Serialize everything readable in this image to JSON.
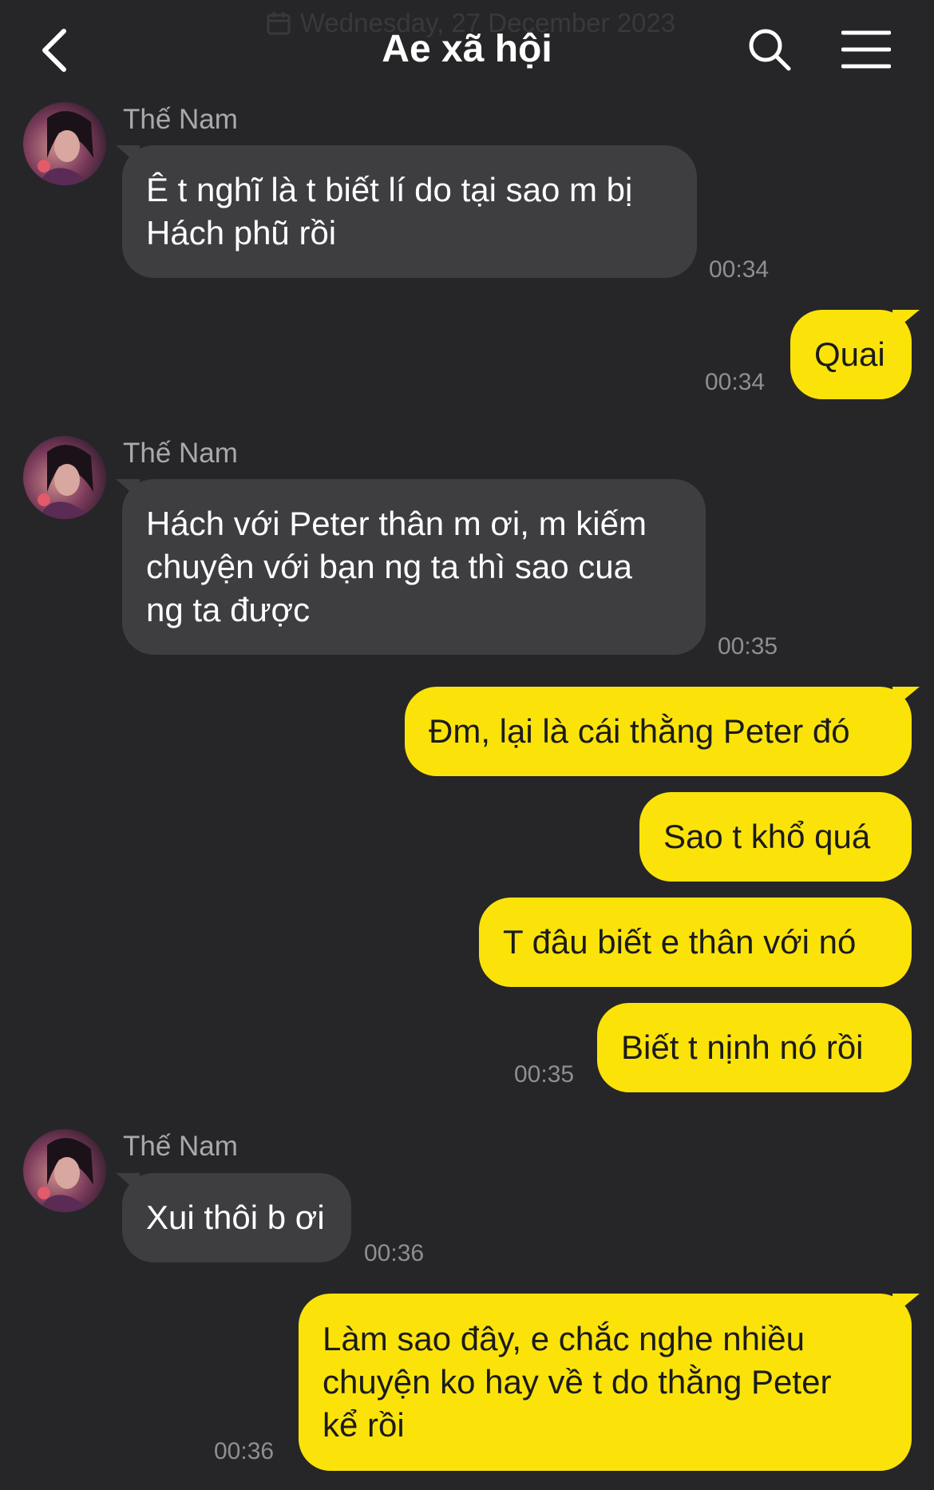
{
  "header": {
    "date": "Wednesday, 27 December 2023",
    "title": "Ae xã hội",
    "icons": {
      "back": "chevron-left-icon",
      "search": "search-icon",
      "menu": "hamburger-menu-icon",
      "date": "calendar-icon"
    }
  },
  "colors": {
    "background": "#262628",
    "incoming_bubble": "#3e3e41",
    "outgoing_bubble": "#fbe30a",
    "outgoing_text": "#1b1b1b",
    "timestamp": "#8e8e93",
    "sender_name": "#a9a9ad"
  },
  "messages": [
    {
      "direction": "incoming",
      "sender": "Thế Nam",
      "lines": [
        "Ê t nghĩ là t biết lí do tại sao m bị",
        "Hách phũ rồi"
      ],
      "time": "00:34"
    },
    {
      "direction": "outgoing",
      "lines": [
        "Quai"
      ],
      "time": "00:34"
    },
    {
      "direction": "incoming",
      "sender": "Thế Nam",
      "lines": [
        "Hách với Peter thân m ơi, m kiếm",
        "chuyện với bạn ng ta thì sao cua",
        "ng ta được"
      ],
      "time": "00:35"
    },
    {
      "direction": "outgoing",
      "lines": [
        "Đm, lại là cái thằng Peter đó"
      ]
    },
    {
      "direction": "outgoing",
      "lines": [
        "Sao t khổ quá"
      ]
    },
    {
      "direction": "outgoing",
      "lines": [
        "T đâu biết e thân với nó"
      ]
    },
    {
      "direction": "outgoing",
      "lines": [
        "Biết t nịnh nó rồi"
      ],
      "time": "00:35"
    },
    {
      "direction": "incoming",
      "sender": "Thế Nam",
      "lines": [
        "Xui thôi b ơi"
      ],
      "time": "00:36"
    },
    {
      "direction": "outgoing",
      "lines": [
        "Làm sao đây, e chắc nghe nhiều",
        "chuyện ko hay về t do thằng Peter",
        "kể rồi"
      ],
      "time": "00:36"
    }
  ]
}
